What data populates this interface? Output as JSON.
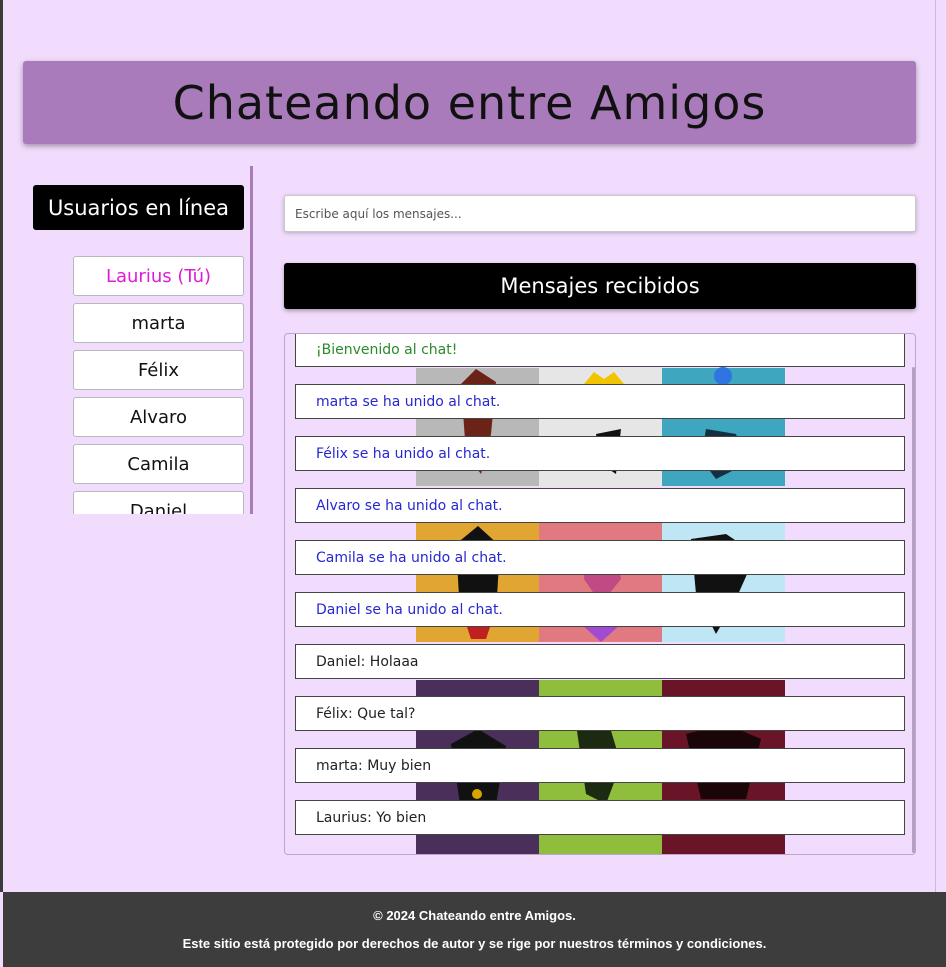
{
  "header": {
    "title": "Chateando entre Amigos"
  },
  "sidebar": {
    "title": "Usuarios en línea",
    "users": [
      "Laurius (Tú)",
      "marta",
      "Félix",
      "Alvaro",
      "Camila",
      "Daniel"
    ]
  },
  "input": {
    "placeholder": "Escribe aquí los mensajes..."
  },
  "received": {
    "title": "Mensajes recibidos",
    "messages": [
      {
        "text": "¡Bienvenido al chat!",
        "kind": "welcome"
      },
      {
        "text": "marta se ha unido al chat.",
        "kind": "join"
      },
      {
        "text": "Félix se ha unido al chat.",
        "kind": "join"
      },
      {
        "text": "Alvaro se ha unido al chat.",
        "kind": "join"
      },
      {
        "text": "Camila se ha unido al chat.",
        "kind": "join"
      },
      {
        "text": "Daniel se ha unido al chat.",
        "kind": "join"
      },
      {
        "text": "Daniel: Holaaa",
        "kind": "chat"
      },
      {
        "text": "Félix: Que tal?",
        "kind": "chat"
      },
      {
        "text": "marta: Muy bien",
        "kind": "chat"
      },
      {
        "text": "Laurius: Yo bien",
        "kind": "chat"
      }
    ]
  },
  "footer": {
    "copyright": "© 2024 Chateando entre Amigos.",
    "legal": "Este sitio está protegido por derechos de autor y se rige por nuestros términos y condiciones."
  },
  "colors": {
    "background": "#f2dcfd",
    "header": "#a97bbb",
    "self_user": "#e21ad8",
    "welcome": "#2a8a2a",
    "join": "#2727d0",
    "footer": "#3d3d3d"
  }
}
